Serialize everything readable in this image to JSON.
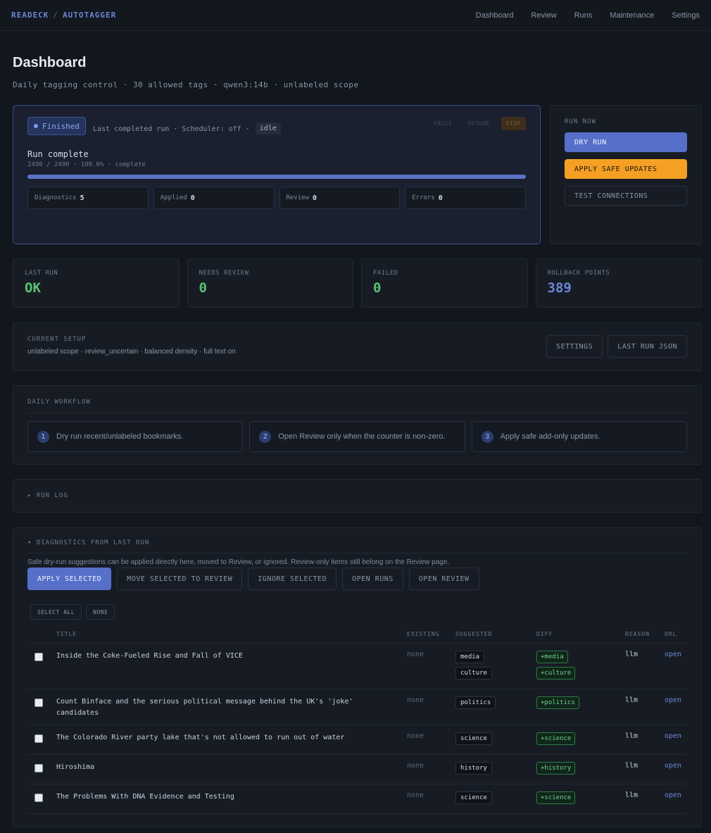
{
  "nav": {
    "brand_left": "READECK",
    "brand_sep": "/",
    "brand_right": "AUTOTAGGER",
    "links": [
      "Dashboard",
      "Review",
      "Runs",
      "Maintenance",
      "Settings"
    ]
  },
  "page": {
    "title": "Dashboard",
    "subtitle": "Daily tagging control · 30 allowed tags · qwen3:14b · unlabeled scope"
  },
  "run": {
    "status": "Finished",
    "last_info": "Last completed run · Scheduler: off ·",
    "state": "idle",
    "pause": "PAUSE",
    "resume": "RESUME",
    "stop": "STOP",
    "title": "Run complete",
    "detail": "2490 / 2490 · 100.0% · complete",
    "progress": 1.0,
    "stats": [
      {
        "label": "Diagnostics",
        "value": "5"
      },
      {
        "label": "Applied",
        "value": "0"
      },
      {
        "label": "Review",
        "value": "0"
      },
      {
        "label": "Errors",
        "value": "0"
      }
    ]
  },
  "run_now": {
    "label": "RUN NOW",
    "dry_run": "DRY RUN",
    "apply": "APPLY SAFE UPDATES",
    "test": "TEST CONNECTIONS"
  },
  "stats": [
    {
      "label": "LAST RUN",
      "value": "OK",
      "color": "#58c471"
    },
    {
      "label": "NEEDS REVIEW",
      "value": "0",
      "color": "#58c471"
    },
    {
      "label": "FAILED",
      "value": "0",
      "color": "#58c471"
    },
    {
      "label": "ROLLBACK POINTS",
      "value": "389",
      "color": "#6b86d6"
    }
  ],
  "setup": {
    "label": "CURRENT SETUP",
    "desc": "unlabeled scope · review_uncertain · balanced density · full text on",
    "settings": "SETTINGS",
    "last_run_json": "LAST RUN JSON"
  },
  "workflow": {
    "label": "DAILY WORKFLOW",
    "steps": [
      {
        "num": "1",
        "text": "Dry run recent/unlabeled bookmarks."
      },
      {
        "num": "2",
        "text": "Open Review only when the counter is non-zero."
      },
      {
        "num": "3",
        "text": "Apply safe add-only updates."
      }
    ]
  },
  "runlog": {
    "label": "▸ RUN LOG"
  },
  "diagnostics": {
    "label": "▾ DIAGNOSTICS FROM LAST RUN",
    "info": "Safe dry-run suggestions can be applied directly here, moved to Review, or ignored. Review-only items still belong on the Review page.",
    "buttons": [
      "APPLY SELECTED",
      "MOVE SELECTED TO REVIEW",
      "IGNORE SELECTED",
      "OPEN RUNS",
      "OPEN REVIEW"
    ],
    "select_all": "SELECT ALL",
    "none": "NONE",
    "columns": [
      "TITLE",
      "EXISTING",
      "SUGGESTED",
      "DIFF",
      "REASON",
      "URL"
    ],
    "rows": [
      {
        "title": "Inside the Coke-Fueled Rise and Fall of VICE",
        "existing": "none",
        "suggested": [
          "media",
          "culture"
        ],
        "diff": [
          "+media",
          "+culture"
        ],
        "reason": "llm",
        "url": "open"
      },
      {
        "title": "Count Binface and the serious political message behind the UK's 'joke' candidates",
        "existing": "none",
        "suggested": [
          "politics"
        ],
        "diff": [
          "+politics"
        ],
        "reason": "llm",
        "url": "open"
      },
      {
        "title": "The Colorado River party lake that's not allowed to run out of water",
        "existing": "none",
        "suggested": [
          "science"
        ],
        "diff": [
          "+science"
        ],
        "reason": "llm",
        "url": "open"
      },
      {
        "title": "Hiroshima",
        "existing": "none",
        "suggested": [
          "history"
        ],
        "diff": [
          "+history"
        ],
        "reason": "llm",
        "url": "open"
      },
      {
        "title": "The Problems With DNA Evidence and Testing",
        "existing": "none",
        "suggested": [
          "science"
        ],
        "diff": [
          "+science"
        ],
        "reason": "llm",
        "url": "open"
      }
    ]
  }
}
